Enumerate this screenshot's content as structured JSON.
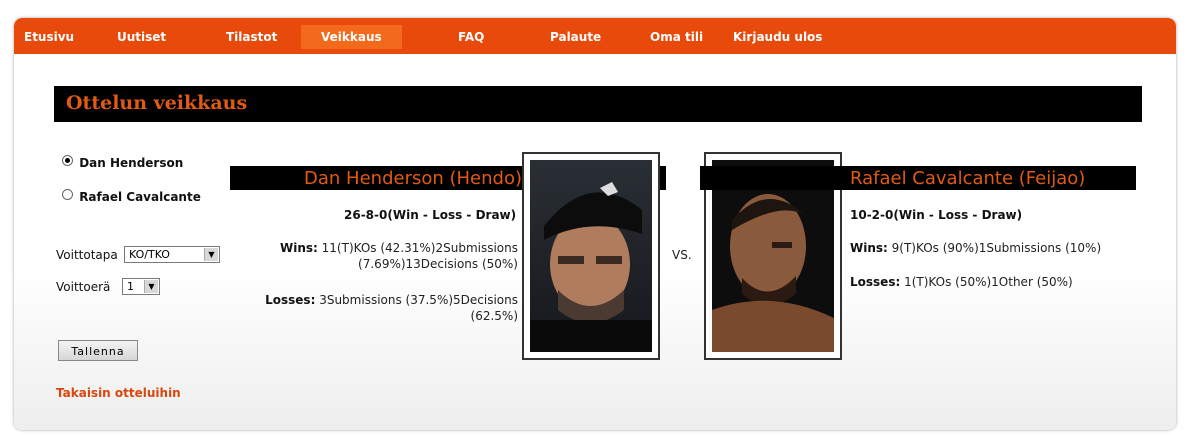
{
  "nav": {
    "items": [
      {
        "label": "Etusivu"
      },
      {
        "label": "Uutiset"
      },
      {
        "label": "Tilastot"
      },
      {
        "label": "Veikkaus"
      },
      {
        "label": "FAQ"
      },
      {
        "label": "Palaute"
      },
      {
        "label": "Oma tili"
      },
      {
        "label": "Kirjaudu ulos"
      }
    ],
    "active": "Veikkaus"
  },
  "page": {
    "title": "Ottelun veikkaus"
  },
  "form": {
    "winner_options": [
      "Dan Henderson",
      "Rafael Cavalcante"
    ],
    "selected_winner": "Dan Henderson",
    "method_label": "Voittotapa",
    "method_value": "KO/TKO",
    "round_label": "Voittoerä",
    "round_value": "1",
    "save_label": "Tallenna"
  },
  "back_link": "Takaisin otteluihin",
  "vs_label": "VS.",
  "fighter1": {
    "name": "Dan Henderson (Hendo)",
    "record": "26-8-0(Win - Loss - Draw)",
    "wins_label": "Wins:",
    "wins_text": " 11(T)KOs (42.31%)2Submissions (7.69%)13Decisions (50%)",
    "losses_label": "Losses:",
    "losses_text": " 3Submissions (37.5%)5Decisions (62.5%)"
  },
  "fighter2": {
    "name": "Rafael Cavalcante (Feijao)",
    "record": "10-2-0(Win - Loss - Draw)",
    "wins_label": "Wins:",
    "wins_text": " 9(T)KOs (90%)1Submissions (10%)",
    "losses_label": "Losses:",
    "losses_text": " 1(T)KOs (50%)1Other (50%)"
  },
  "colors": {
    "nav_bg": "#e84a0b",
    "nav_active": "#f46a1c",
    "accent_text": "#e05a14",
    "title_bar": "#000000"
  }
}
